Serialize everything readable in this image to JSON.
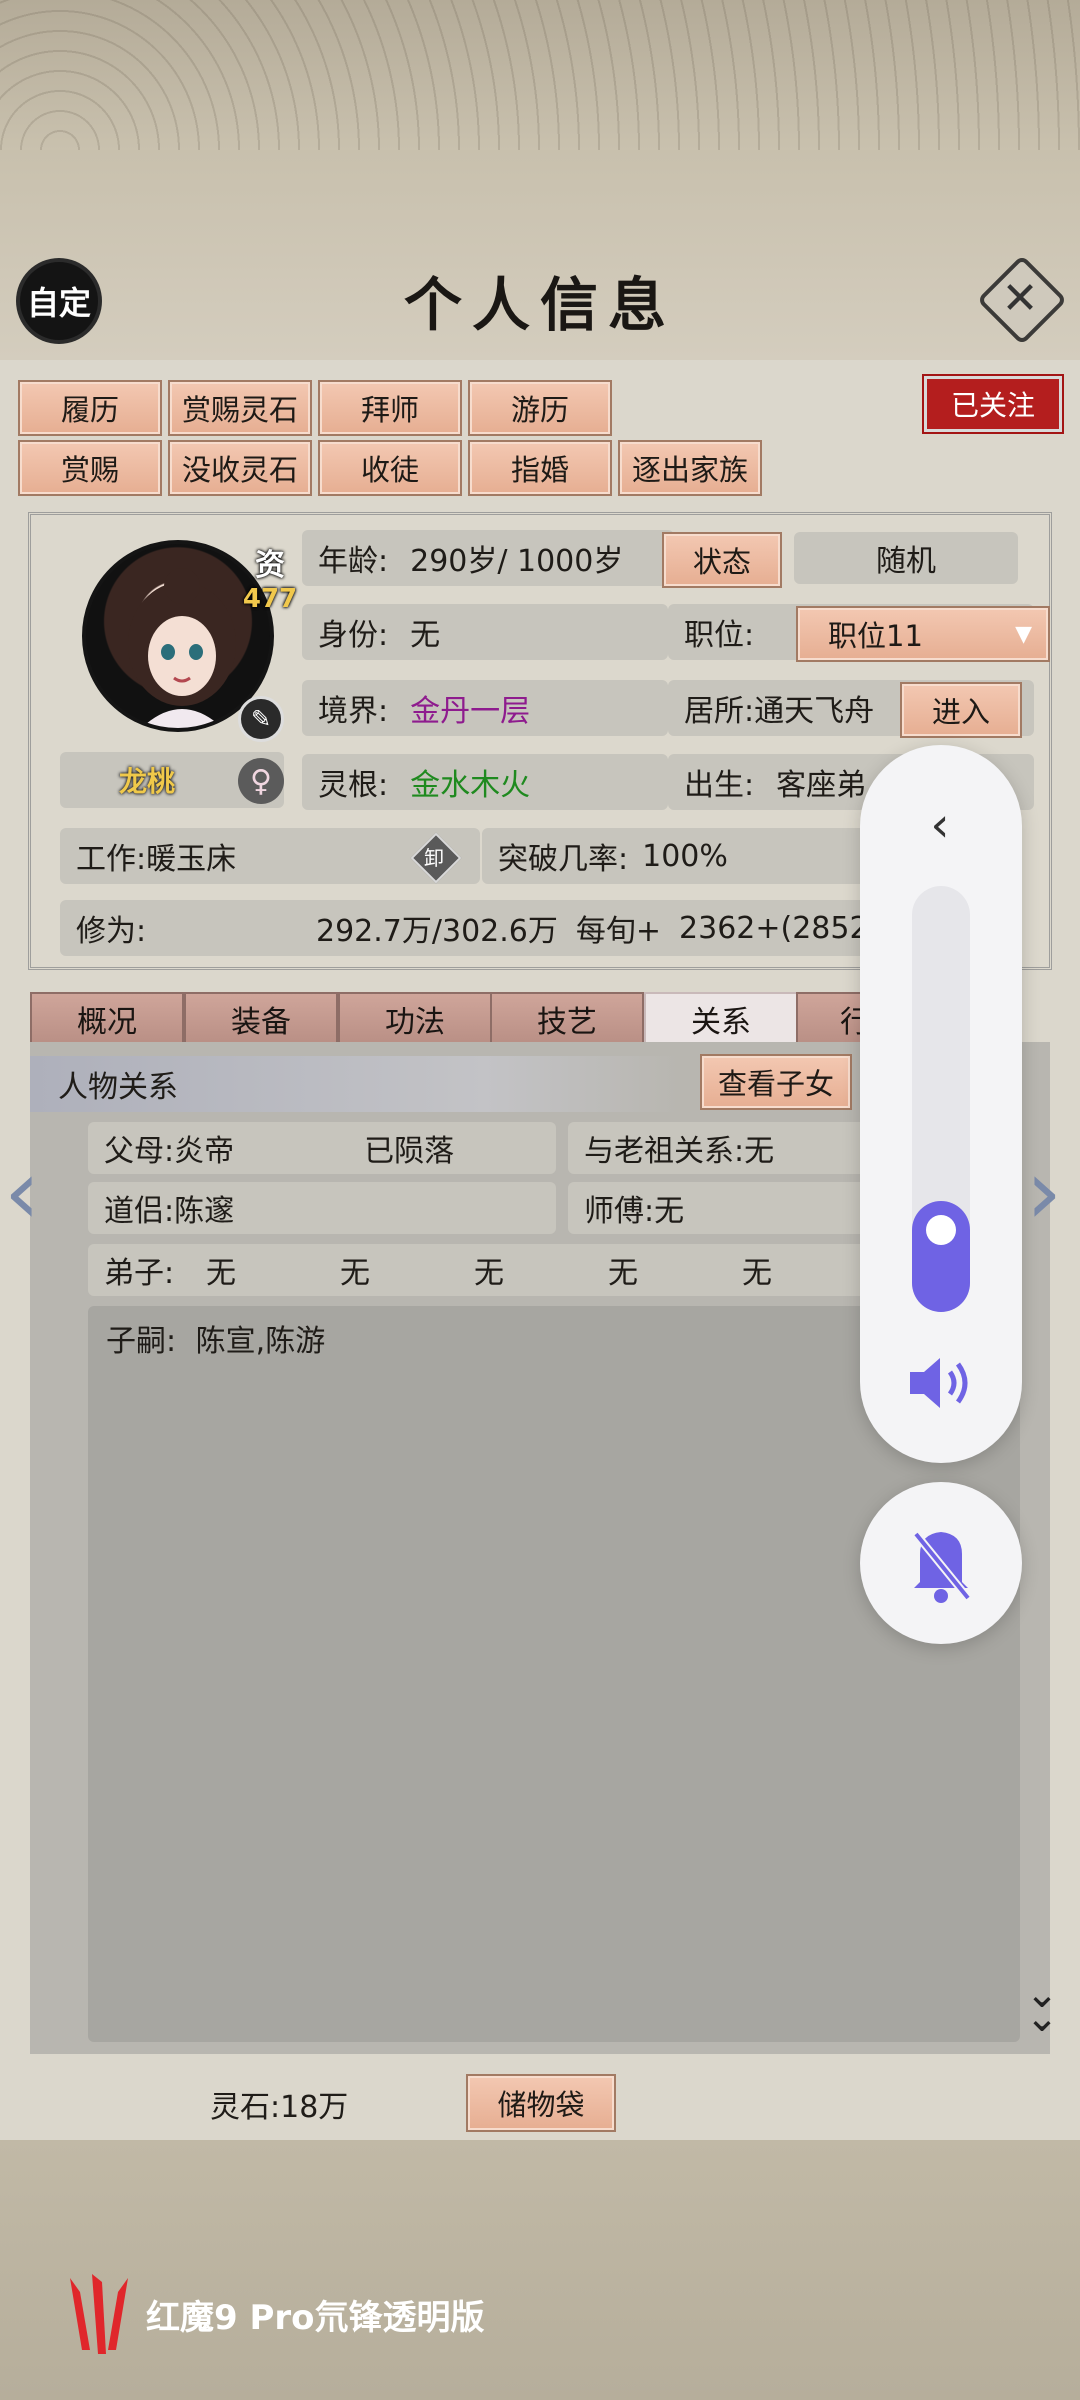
{
  "header": {
    "customize_label": "自定",
    "title": "个人信息",
    "close_icon": "close-icon"
  },
  "actions": {
    "row1": [
      "履历",
      "赏赐灵石",
      "拜师",
      "游历"
    ],
    "row2": [
      "赏赐",
      "没收灵石",
      "收徒",
      "指婚",
      "逐出家族"
    ],
    "followed_label": "已关注"
  },
  "profile": {
    "aptitude_char": "资",
    "aptitude_value": "477",
    "name": "龙桃",
    "gender_icon": "female-icon",
    "age_label": "年龄:",
    "age_value": "290岁/ 1000岁",
    "status_button": "状态",
    "random_button": "随机",
    "identity_label": "身份:",
    "identity_value": "无",
    "position_label": "职位:",
    "position_value": "职位11",
    "realm_label": "境界:",
    "realm_value": "金丹一层",
    "residence_label": "居所: ",
    "residence_value": "通天飞舟",
    "enter_button": "进入",
    "root_label": "灵根:",
    "root_value": "金水木火",
    "birth_label": "出生:",
    "birth_value": "客座弟",
    "work_label": "工作:",
    "work_value": "暖玉床",
    "unequip_label": "卸",
    "breakthrough_label": "突破几率:",
    "breakthrough_value": "100%",
    "cultivation_label": "修为:",
    "cultivation_value": "292.7万/302.6万",
    "per_turn_label": "每旬+",
    "per_turn_value": "2362+(2852"
  },
  "tabs": [
    "概况",
    "装备",
    "功法",
    "技艺",
    "关系",
    "行"
  ],
  "active_tab": "关系",
  "relations": {
    "section_title": "人物关系",
    "view_children_button": "查看子女",
    "parents_label": "父母: ",
    "parents_value": "炎帝",
    "parents_status": "已陨落",
    "ancestor_label": "与老祖关系: ",
    "ancestor_value": "无",
    "partner_label": "道侣:",
    "partner_value": "陈邃",
    "master_label": "师傅: ",
    "master_value": "无",
    "disciples_label": "弟子:",
    "disciples": [
      "无",
      "无",
      "无",
      "无",
      "无"
    ],
    "heirs_label": "子嗣:",
    "heirs_value": "陈宣,陈游"
  },
  "footer": {
    "spirit_stones_label": "灵石: ",
    "spirit_stones_value": "18万",
    "storage_bag_button": "储物袋"
  },
  "watermark": {
    "text": "红魔9 Pro氘锋透明版"
  },
  "volume_overlay": {
    "level": 0.26,
    "accent": "#6f63e4"
  },
  "colors": {
    "realm": "#8e1b8e",
    "root": "#1f8a1f",
    "followed_bg": "#b41e1e",
    "button_peach": "#eeb99f"
  }
}
